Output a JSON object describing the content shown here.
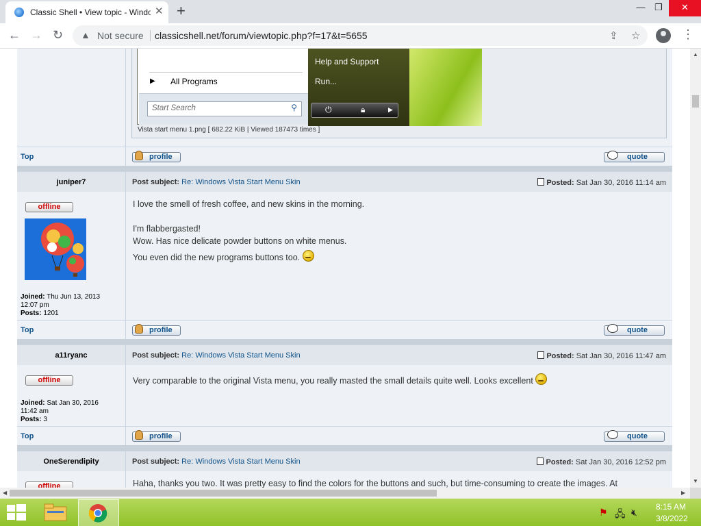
{
  "browser": {
    "tab_title": "Classic Shell • View topic - Windows Vista Start Menu Skin",
    "tab_close": "✕",
    "new_tab": "+",
    "not_secure": "Not secure",
    "url": "classicshell.net/forum/viewtopic.php?f=17&t=5655",
    "win_min": "—",
    "win_max": "❐",
    "win_close": "✕"
  },
  "attachment": {
    "all_programs": "All Programs",
    "search_placeholder": "Start Search",
    "help_support": "Help and Support",
    "run": "Run...",
    "caption": "Vista start menu 1.png [ 682.22 KiB | Viewed 187473 times ]"
  },
  "labels": {
    "top": "Top",
    "profile": "profile",
    "quote": "quote",
    "offline": "offline",
    "post_subject": "Post subject:",
    "posted": "Posted:",
    "joined": "Joined:",
    "posts": "Posts:"
  },
  "posts": [
    {
      "author": "juniper7",
      "subject": "Re: Windows Vista Start Menu Skin",
      "posted_date": "Sat Jan 30, 2016 11:14 am",
      "joined": "Thu Jun 13, 2013",
      "joined_time": "12:07 pm",
      "posts_count": "1201",
      "lines": [
        "I love the smell of fresh coffee, and new skins in the morning.",
        "I'm flabbergasted!",
        "Wow. Has nice delicate powder buttons on white menus.",
        "You even did the new programs buttons too."
      ]
    },
    {
      "author": "a11ryanc",
      "subject": "Re: Windows Vista Start Menu Skin",
      "posted_date": "Sat Jan 30, 2016 11:47 am",
      "joined": "Sat Jan 30, 2016",
      "joined_time": "11:42 am",
      "posts_count": "3",
      "lines": [
        "Very comparable to the original Vista menu, you really masted the small details quite well. Looks excellent"
      ]
    },
    {
      "author": "OneSerendipity",
      "subject": "Re: Windows Vista Start Menu Skin",
      "posted_date": "Sat Jan 30, 2016 12:52 pm",
      "lines": [
        "Haha, thanks you two. It was pretty easy to find the colors for the buttons and such, but time-consuming to create the images. At"
      ]
    }
  ],
  "taskbar": {
    "time": "8:15 AM",
    "date": "3/8/2022"
  }
}
